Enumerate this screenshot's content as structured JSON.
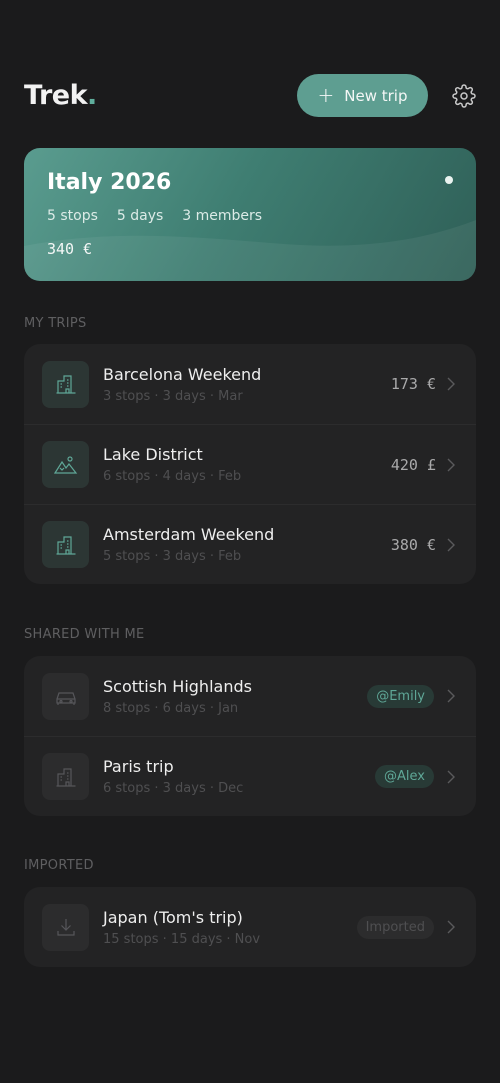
{
  "app": {
    "logo_text": "Trek",
    "logo_dot": "."
  },
  "header": {
    "new_trip_label": "New trip",
    "plus_glyph": "+"
  },
  "featured": {
    "title": "Italy 2026",
    "stops": "5 stops",
    "days": "5 days",
    "members": "3 members",
    "price": "340 €"
  },
  "sections": {
    "my_trips": "MY TRIPS",
    "shared": "SHARED WITH ME",
    "imported": "IMPORTED"
  },
  "my_trips": [
    {
      "name": "Barcelona Weekend",
      "sub": "3 stops · 3 days · Mar",
      "amount": "173 €",
      "icon": "city-icon"
    },
    {
      "name": "Lake District",
      "sub": "6 stops · 4 days · Feb",
      "amount": "420 £",
      "icon": "mountain-icon"
    },
    {
      "name": "Amsterdam Weekend",
      "sub": "5 stops · 3 days · Feb",
      "amount": "380 €",
      "icon": "city-icon"
    }
  ],
  "shared": [
    {
      "name": "Scottish Highlands",
      "sub": "8 stops · 6 days · Jan",
      "badge": "@Emily",
      "icon": "car-icon"
    },
    {
      "name": "Paris trip",
      "sub": "6 stops · 3 days · Dec",
      "badge": "@Alex",
      "icon": "city-icon"
    }
  ],
  "imported": [
    {
      "name": "Japan (Tom's trip)",
      "sub": "15 stops · 15 days · Nov",
      "badge": "Imported",
      "icon": "download-icon"
    }
  ],
  "colors": {
    "accent": "#5e9e91",
    "background": "#1b1b1c",
    "card": "#232324"
  }
}
